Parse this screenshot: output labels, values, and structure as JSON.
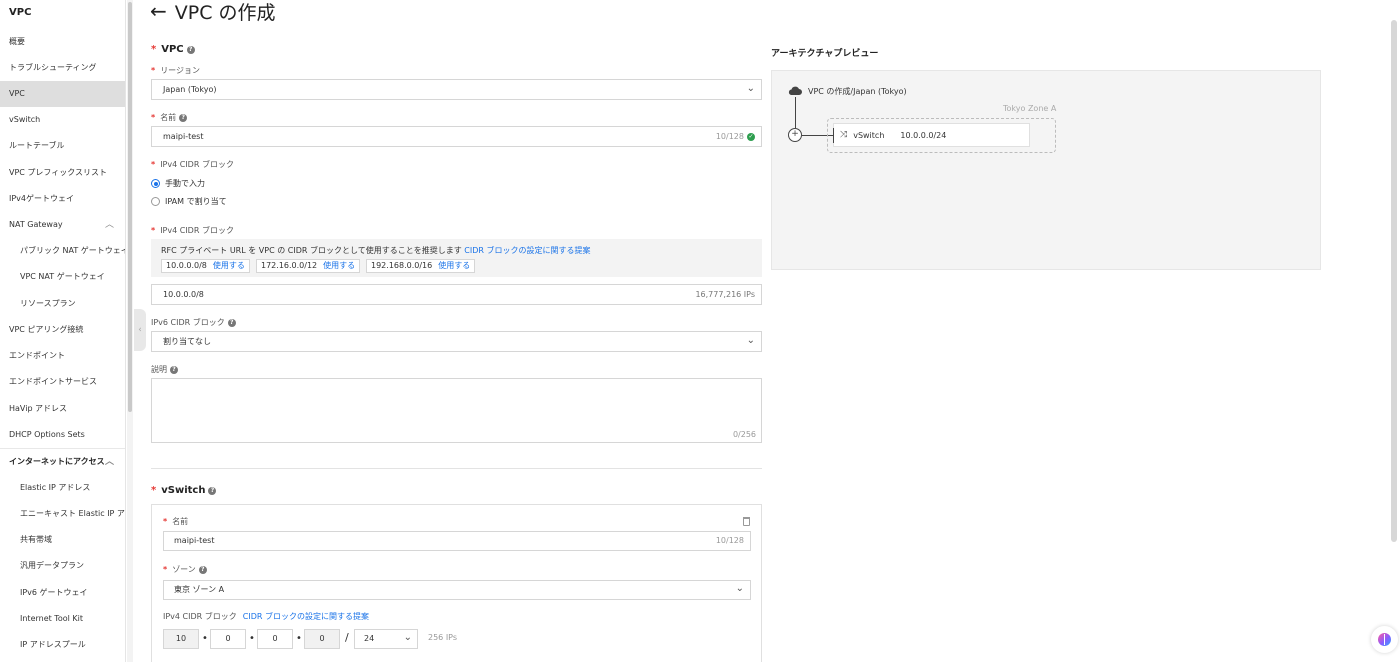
{
  "sidebar": {
    "title": "VPC",
    "items": [
      {
        "label": "概要"
      },
      {
        "label": "トラブルシューティング"
      },
      {
        "label": "VPC"
      },
      {
        "label": "vSwitch"
      },
      {
        "label": "ルートテーブル"
      },
      {
        "label": "VPC プレフィックスリスト"
      },
      {
        "label": "IPv4ゲートウェイ"
      },
      {
        "label": "NAT Gateway"
      },
      {
        "label": "パブリック NAT ゲートウェイ"
      },
      {
        "label": "VPC NAT ゲートウェイ"
      },
      {
        "label": "リソースプラン"
      },
      {
        "label": "VPC ピアリング接続"
      },
      {
        "label": "エンドポイント"
      },
      {
        "label": "エンドポイントサービス"
      },
      {
        "label": "HaVip アドレス"
      },
      {
        "label": "DHCP Options Sets"
      },
      {
        "label": "インターネットにアクセス"
      },
      {
        "label": "Elastic IP アドレス"
      },
      {
        "label": "エニーキャスト Elastic IP アドレス"
      },
      {
        "label": "共有帯域"
      },
      {
        "label": "汎用データプラン"
      },
      {
        "label": "IPv6 ゲートウェイ"
      },
      {
        "label": "Internet Tool Kit"
      },
      {
        "label": "IP アドレスプール"
      }
    ]
  },
  "header": {
    "title": "VPC の作成"
  },
  "form": {
    "vpc_section": "VPC",
    "region_label": "リージョン",
    "region_value": "Japan (Tokyo)",
    "name_label": "名前",
    "name_value": "maipi-test",
    "name_counter": "10/128",
    "ipv4_mode_label": "IPv4 CIDR ブロック",
    "radio_manual": "手動で入力",
    "radio_ipam": "IPAM で割り当て",
    "ipv4_label": "IPv4 CIDR ブロック",
    "rec_text": "RFC プライベート URL を VPC の CIDR ブロックとして使用することを推奨します",
    "rec_link": "CIDR ブロックの設定に関する提案",
    "chips": [
      {
        "cidr": "10.0.0.0/8",
        "action": "使用する"
      },
      {
        "cidr": "172.16.0.0/12",
        "action": "使用する"
      },
      {
        "cidr": "192.168.0.0/16",
        "action": "使用する"
      }
    ],
    "cidr_value": "10.0.0.0/8",
    "cidr_ips": "16,777,216 IPs",
    "ipv6_label": "IPv6 CIDR ブロック",
    "ipv6_value": "割り当てなし",
    "desc_label": "説明",
    "desc_counter": "0/256"
  },
  "vswitch": {
    "section": "vSwitch",
    "name_label": "名前",
    "name_value": "maipi-test",
    "name_counter": "10/128",
    "zone_label": "ゾーン",
    "zone_value": "東京 ゾーン A",
    "cidr_label": "IPv4 CIDR ブロック",
    "cidr_link": "CIDR ブロックの設定に関する提案",
    "octets": [
      "10",
      "0",
      "0",
      "0"
    ],
    "mask": "24",
    "ips": "256 IPs"
  },
  "preview": {
    "title": "アーキテクチャプレビュー",
    "vpc_label": "VPC の作成/Japan (Tokyo)",
    "zone": "Tokyo Zone A",
    "vswitch_name": "vSwitch",
    "vswitch_cidr": "10.0.0.0/24"
  },
  "icons": {
    "back": "arrow-left-icon",
    "help": "question-circle-icon",
    "ok": "check-circle-icon",
    "trash": "trash-icon",
    "cloud": "cloud-icon",
    "router": "router-icon",
    "shuffle": "shuffle-icon",
    "assistant": "brain-icon"
  },
  "colors": {
    "accent": "#1a73e8",
    "required": "#e53935",
    "success": "#2e9e4f",
    "sidebar_active": "#dedede"
  }
}
